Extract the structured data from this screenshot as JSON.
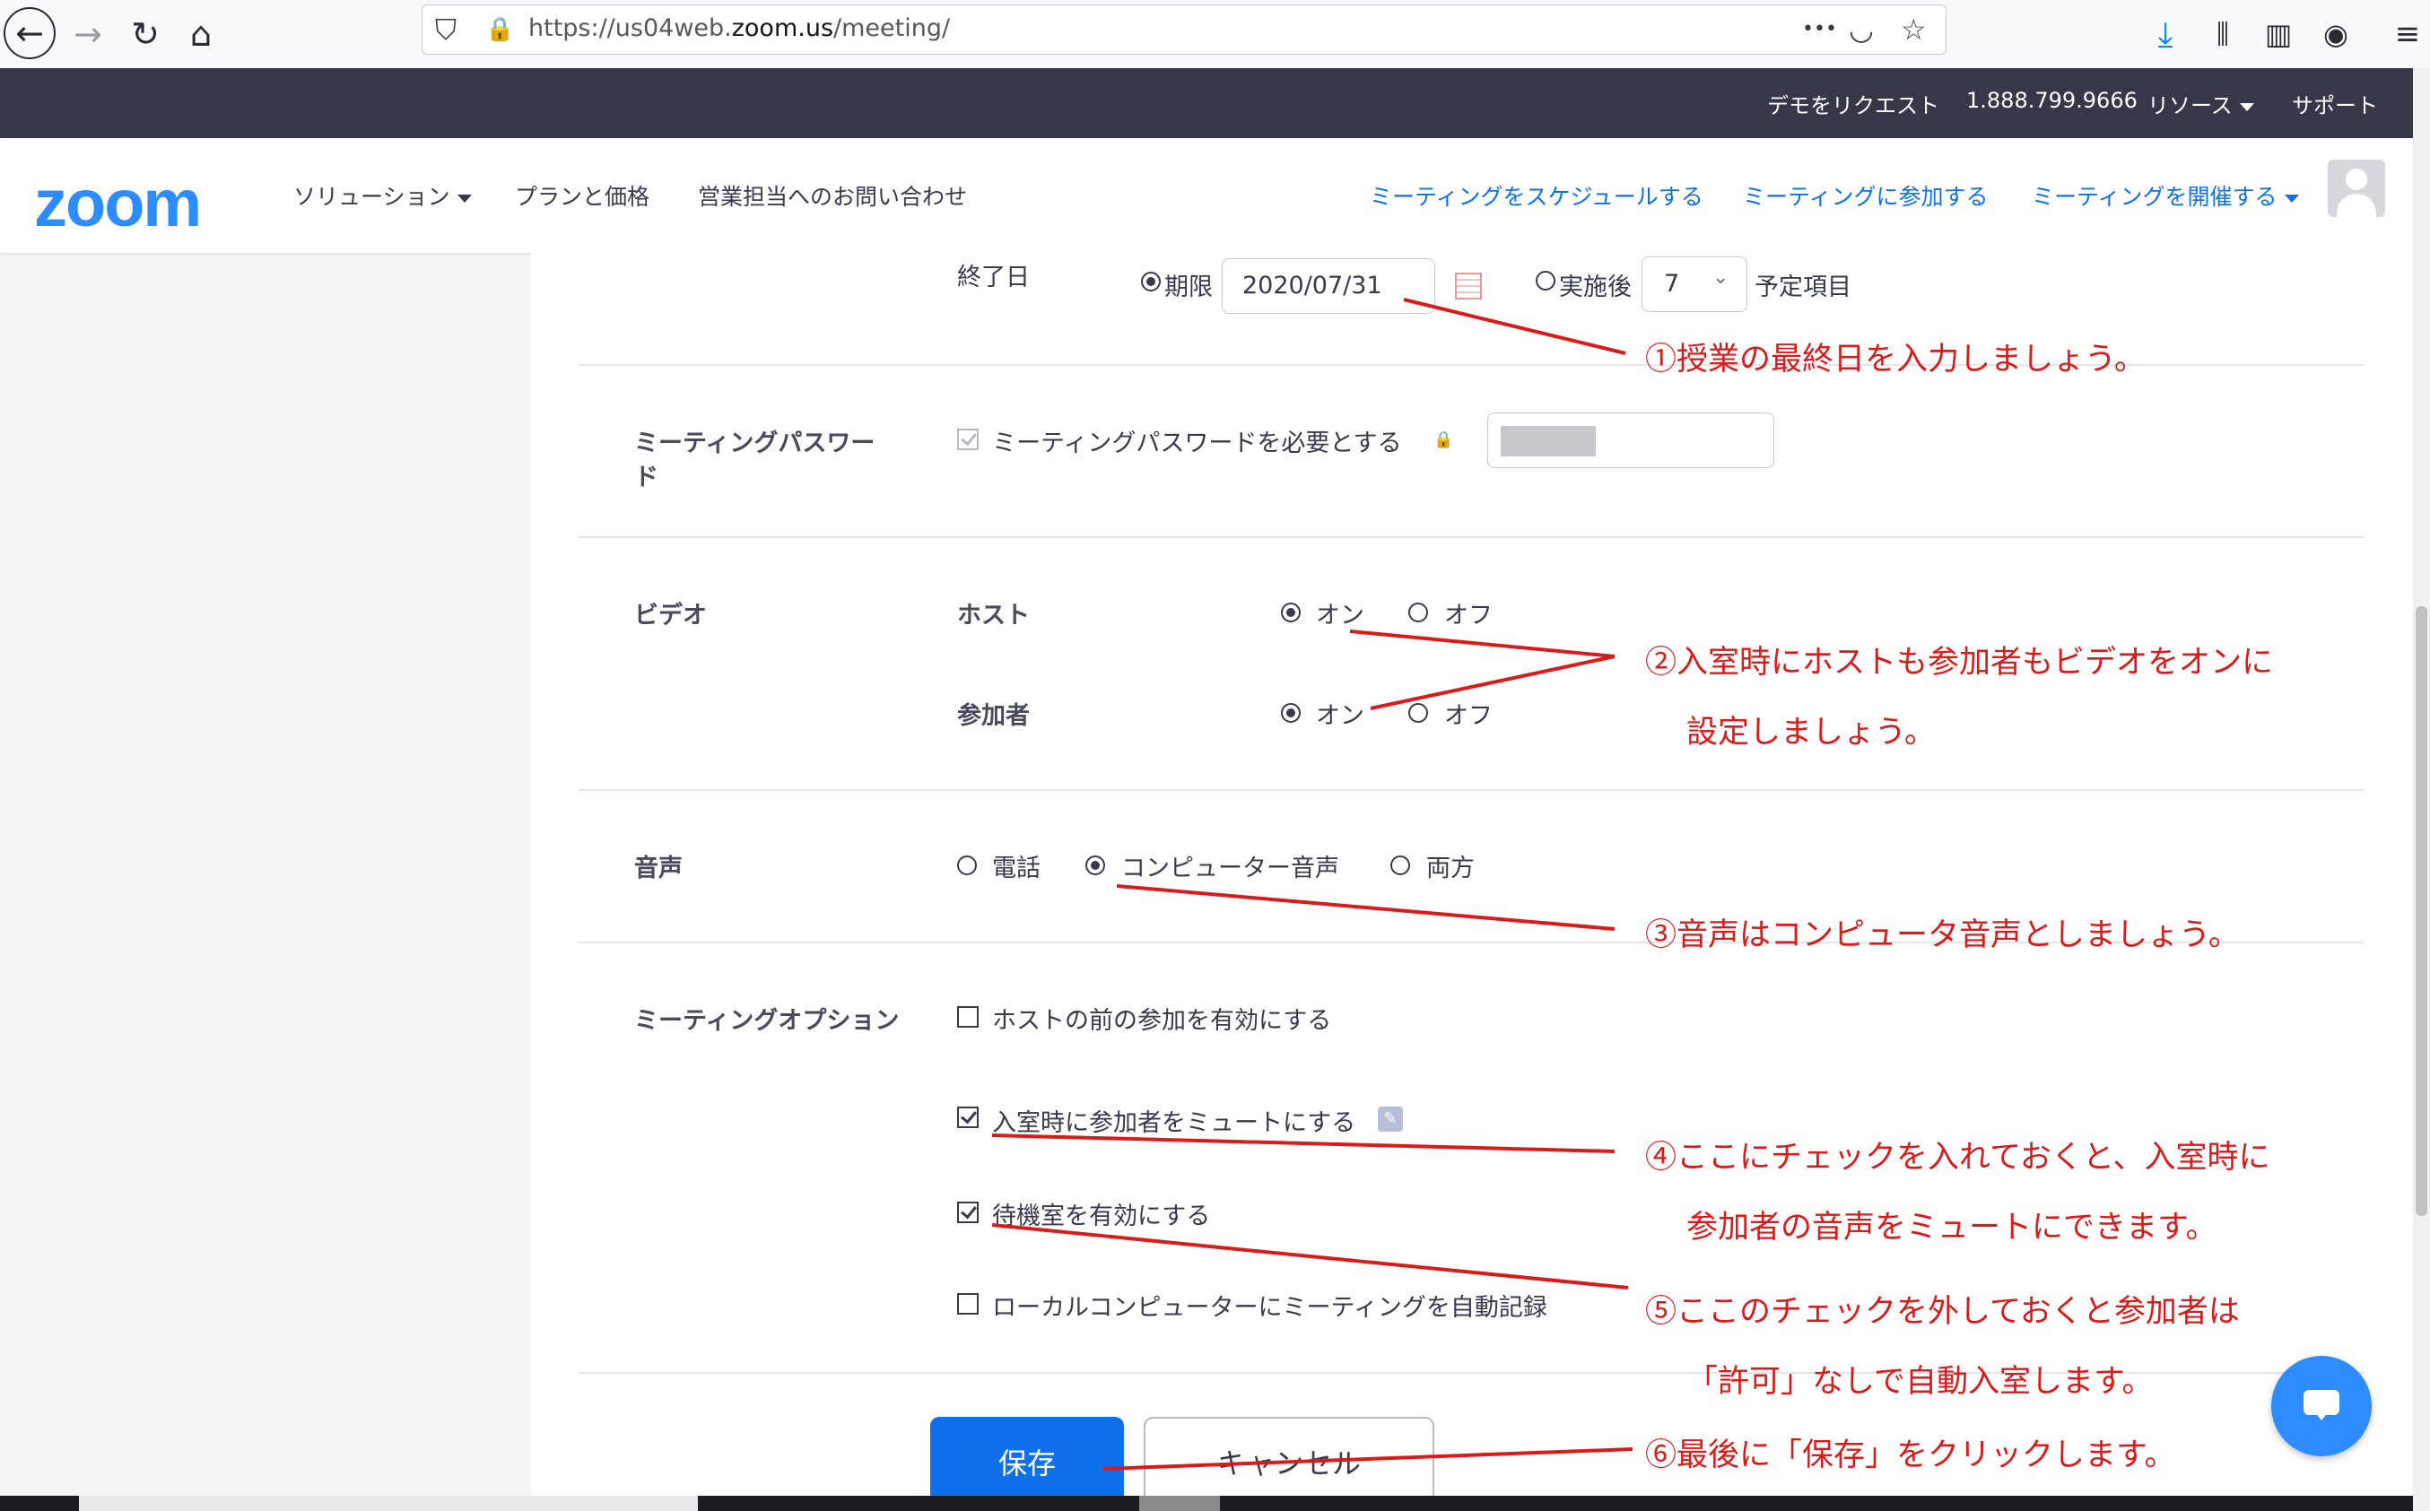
{
  "browser": {
    "url_prefix": "https://us04web.",
    "url_domain": "zoom.us",
    "url_path": "/meeting/",
    "more_icon": "•••"
  },
  "topbar": {
    "request_demo": "デモをリクエスト",
    "phone": "1.888.799.9666",
    "resources": "リソース",
    "support": "サポート"
  },
  "nav": {
    "logo": "zoom",
    "solutions": "ソリューション",
    "plans": "プランと価格",
    "contact_sales": "営業担当へのお問い合わせ",
    "schedule": "ミーティングをスケジュールする",
    "join": "ミーティングに参加する",
    "host": "ミーティングを開催する"
  },
  "form": {
    "end_date": {
      "label": "終了日",
      "by_label": "期限",
      "date_value": "2020/07/31",
      "after_label": "実施後",
      "occurrences_value": "7",
      "occurrences_suffix": "予定項目"
    },
    "password": {
      "label_line1": "ミーティングパスワー",
      "label_line2": "ド",
      "checkbox_label": "ミーティングパスワードを必要とする"
    },
    "video": {
      "label": "ビデオ",
      "host_label": "ホスト",
      "participant_label": "参加者",
      "on": "オン",
      "off": "オフ"
    },
    "audio": {
      "label": "音声",
      "telephone": "電話",
      "computer": "コンピューター音声",
      "both": "両方"
    },
    "options": {
      "label": "ミーティングオプション",
      "join_before_host": "ホストの前の参加を有効にする",
      "mute_on_entry": "入室時に参加者をミュートにする",
      "waiting_room": "待機室を有効にする",
      "auto_record": "ローカルコンピューターにミーティングを自動記録"
    },
    "save": "保存",
    "cancel": "キャンセル"
  },
  "annotations": {
    "note1": "①授業の最終日を入力しましょう。",
    "note2_line1": "②入室時にホストも参加者もビデオをオンに",
    "note2_line2": "設定しましょう。",
    "note3": "③音声はコンピュータ音声としましょう。",
    "note4_line1": "④ここにチェックを入れておくと、入室時に",
    "note4_line2": "参加者の音声をミュートにできます。",
    "note5_line1": "⑤ここのチェックを外しておくと参加者は",
    "note5_line2": "「許可」なしで自動入室します。",
    "note6": "⑥最後に「保存」をクリックします。",
    "color": "#d91b1b"
  }
}
